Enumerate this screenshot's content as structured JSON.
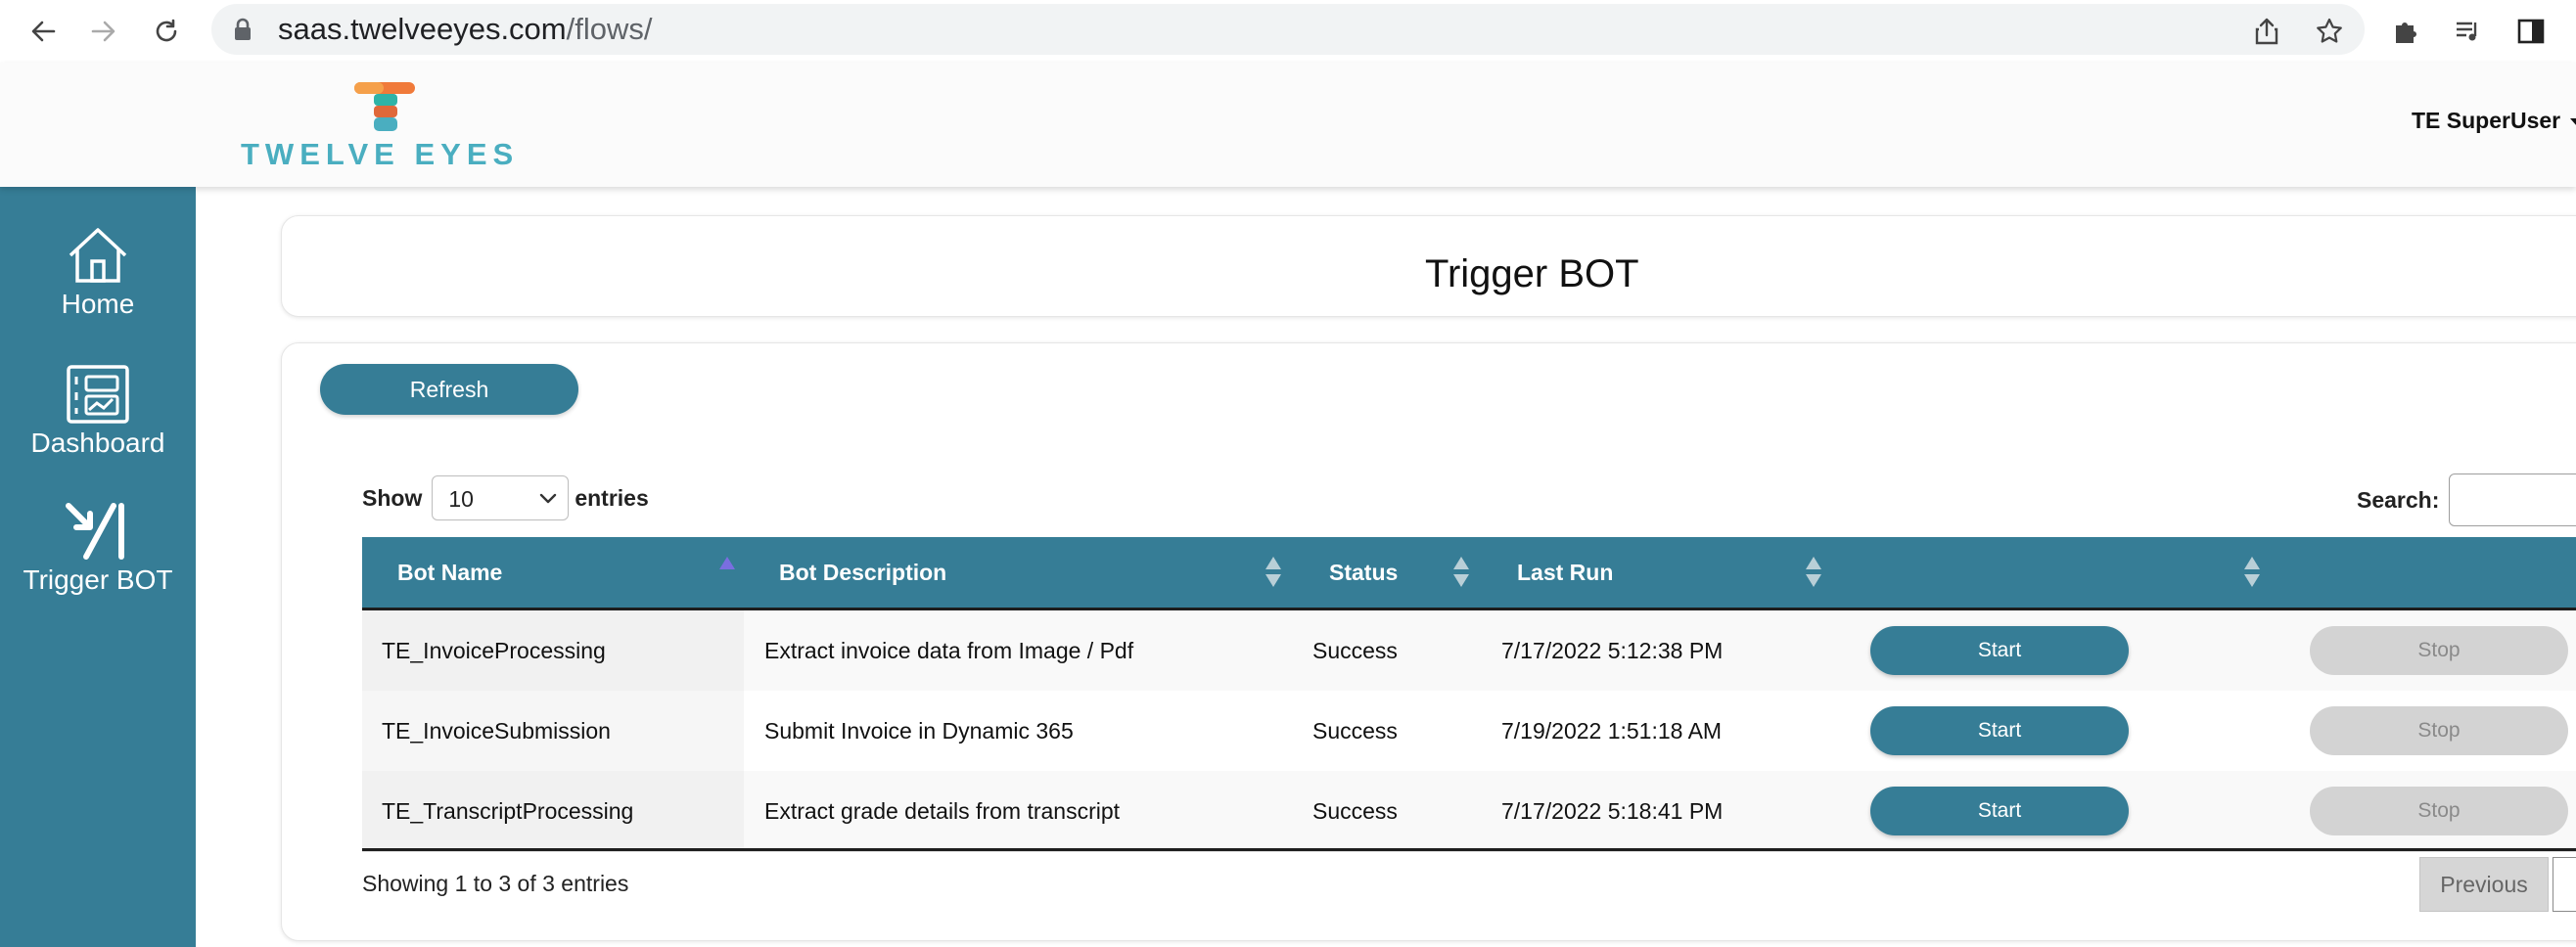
{
  "browser": {
    "url_host": "saas.twelveeyes.com",
    "url_path": "/flows/"
  },
  "header": {
    "brand": "TWELVE EYES",
    "user": "TE SuperUser"
  },
  "sidebar": {
    "items": [
      {
        "label": "Home",
        "icon": "home-icon"
      },
      {
        "label": "Dashboard",
        "icon": "dashboard-icon"
      },
      {
        "label": "Trigger BOT",
        "icon": "trigger-bot-icon"
      }
    ]
  },
  "page": {
    "title": "Trigger BOT"
  },
  "toolbar": {
    "refresh_label": "Refresh"
  },
  "table_controls": {
    "show_label": "Show",
    "entries_value": "10",
    "entries_label": "entries",
    "search_label": "Search:",
    "search_value": ""
  },
  "table": {
    "columns": [
      "Bot Name",
      "Bot Description",
      "Status",
      "Last Run",
      "",
      ""
    ],
    "rows": [
      {
        "name": "TE_InvoiceProcessing",
        "description": "Extract invoice data from Image / Pdf",
        "status": "Success",
        "last_run": "7/17/2022 5:12:38 PM",
        "start": "Start",
        "stop": "Stop"
      },
      {
        "name": "TE_InvoiceSubmission",
        "description": "Submit Invoice in Dynamic 365",
        "status": "Success",
        "last_run": "7/19/2022 1:51:18 AM",
        "start": "Start",
        "stop": "Stop"
      },
      {
        "name": "TE_TranscriptProcessing",
        "description": "Extract grade details from transcript",
        "status": "Success",
        "last_run": "7/17/2022 5:18:41 PM",
        "start": "Start",
        "stop": "Stop"
      }
    ]
  },
  "footer": {
    "info": "Showing 1 to 3 of 3 entries",
    "previous_label": "Previous"
  },
  "colors": {
    "accent": "#367d96",
    "brand": "#4aaec0",
    "disabled": "#d3d3d3"
  }
}
